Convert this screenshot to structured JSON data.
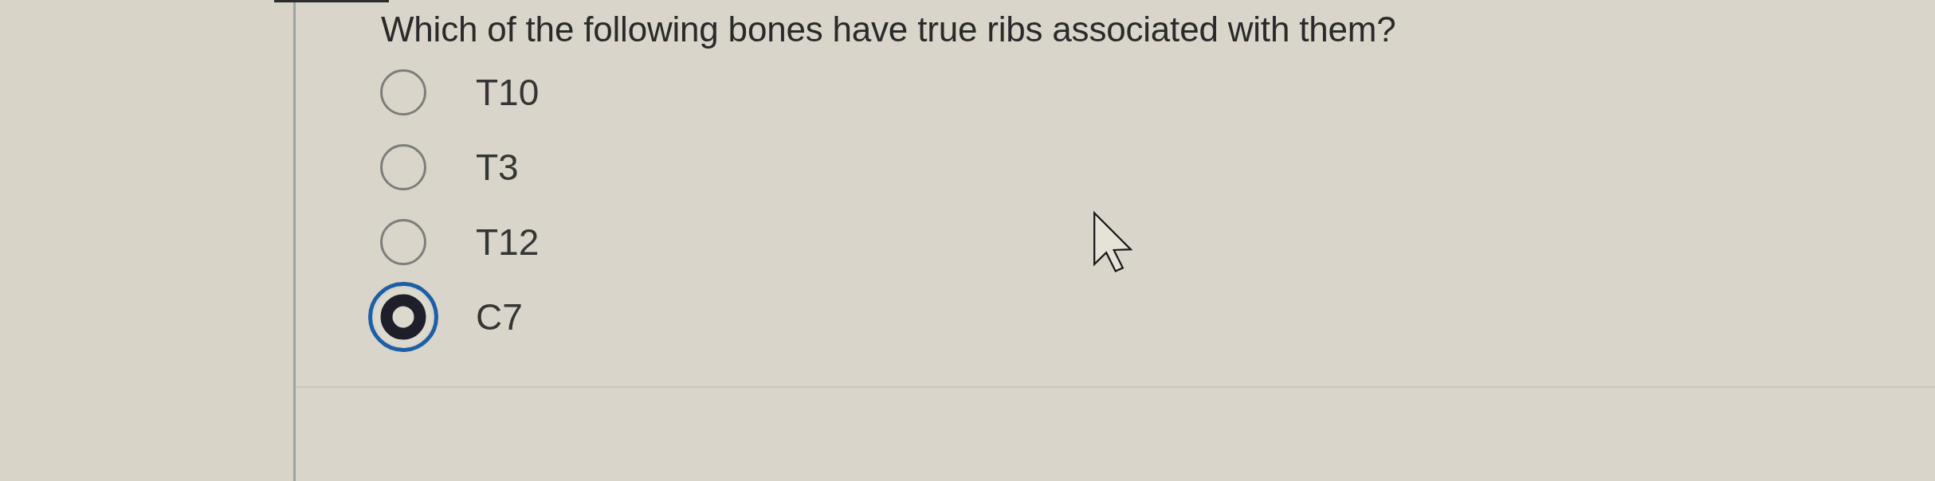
{
  "question": {
    "text": "Which of the following bones have true ribs associated with them?"
  },
  "options": [
    {
      "label": "T10",
      "selected": false
    },
    {
      "label": "T3",
      "selected": false
    },
    {
      "label": "T12",
      "selected": false
    },
    {
      "label": "C7",
      "selected": true
    }
  ]
}
